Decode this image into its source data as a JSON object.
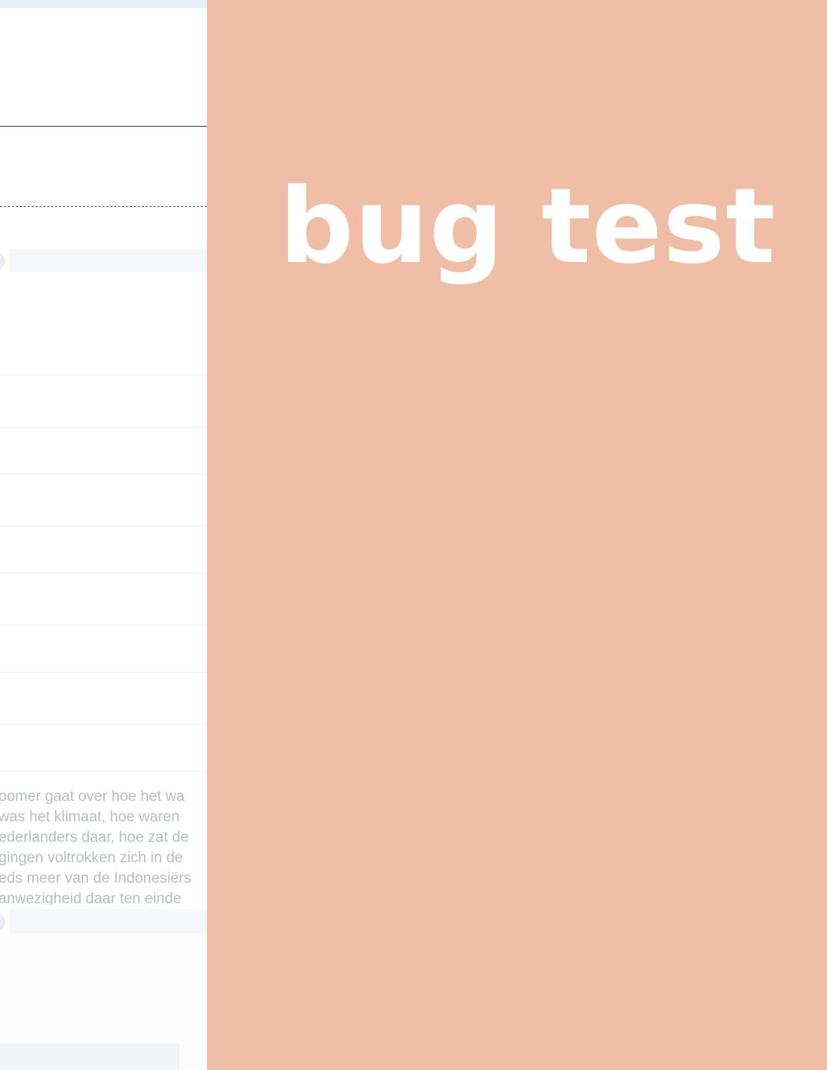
{
  "overlay": {
    "title": "bug test",
    "background_color": "#f0bea6",
    "text_color": "#ffffff"
  },
  "background_page": {
    "description_lines": [
      "oomer gaat over hoe het wa",
      "was het klimaat, hoe waren",
      "ederlanders daar, hoe zat de",
      "gingen voltrokken zich in de",
      "eds meer van de Indonesiërs",
      "anwezigheid daar ten einde"
    ]
  }
}
